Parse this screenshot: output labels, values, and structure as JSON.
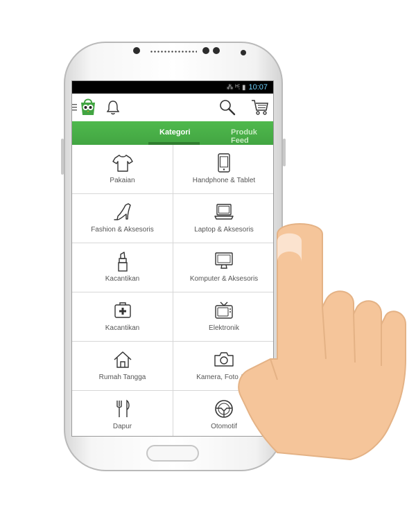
{
  "status": {
    "time": "10:07",
    "icons": "⁂ ᴴ⫶ ▮"
  },
  "tabs": [
    {
      "label": "Kategori"
    },
    {
      "label": "Produk Feed"
    }
  ],
  "categories": [
    {
      "label": "Pakaian",
      "icon": "shirt-icon"
    },
    {
      "label": "Handphone & Tablet",
      "icon": "phone-icon"
    },
    {
      "label": "Fashion & Aksesoris",
      "icon": "high-heel-icon"
    },
    {
      "label": "Laptop & Aksesoris",
      "icon": "laptop-icon"
    },
    {
      "label": "Kacantikan",
      "icon": "lipstick-icon"
    },
    {
      "label": "Komputer & Aksesoris",
      "icon": "monitor-icon"
    },
    {
      "label": "Kacantikan",
      "icon": "medical-kit-icon"
    },
    {
      "label": "Elektronik",
      "icon": "tv-icon"
    },
    {
      "label": "Rumah Tangga",
      "icon": "house-icon"
    },
    {
      "label": "Kamera, Foto & V",
      "icon": "camera-icon"
    },
    {
      "label": "Dapur",
      "icon": "fork-knife-icon"
    },
    {
      "label": "Otomotif",
      "icon": "steering-wheel-icon"
    }
  ],
  "colors": {
    "tab_green": "#4fb94d",
    "status_time": "#6fd3ff",
    "hand_skin": "#f5c59a"
  }
}
